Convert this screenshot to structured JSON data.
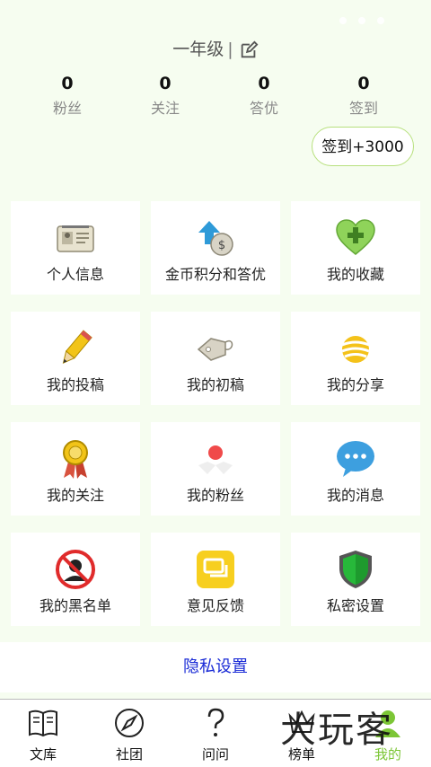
{
  "header": {
    "grade": "一年级",
    "separator": "|",
    "stats": [
      {
        "value": "0",
        "label": "粉丝"
      },
      {
        "value": "0",
        "label": "关注"
      },
      {
        "value": "0",
        "label": "答优"
      },
      {
        "value": "0",
        "label": "签到"
      }
    ],
    "signin_label": "签到+3000"
  },
  "grid": {
    "items": [
      {
        "label": "个人信息",
        "icon": "id-card-icon"
      },
      {
        "label": "金币积分和答优",
        "icon": "coin-upload-icon"
      },
      {
        "label": "我的收藏",
        "icon": "heart-plus-icon"
      },
      {
        "label": "我的投稿",
        "icon": "pencil-icon"
      },
      {
        "label": "我的初稿",
        "icon": "tag-icon"
      },
      {
        "label": "我的分享",
        "icon": "striped-ball-icon"
      },
      {
        "label": "我的关注",
        "icon": "medal-icon"
      },
      {
        "label": "我的粉丝",
        "icon": "red-dot-icon"
      },
      {
        "label": "我的消息",
        "icon": "chat-bubble-icon"
      },
      {
        "label": "我的黑名单",
        "icon": "blocked-person-icon"
      },
      {
        "label": "意见反馈",
        "icon": "feedback-icon"
      },
      {
        "label": "私密设置",
        "icon": "shield-icon"
      }
    ]
  },
  "privacy_link": "隐私设置",
  "tabbar": {
    "tabs": [
      {
        "label": "文库",
        "icon": "book-icon"
      },
      {
        "label": "社团",
        "icon": "compass-icon"
      },
      {
        "label": "问问",
        "icon": "question-icon"
      },
      {
        "label": "榜单",
        "icon": "ranking-icon"
      },
      {
        "label": "我的",
        "icon": "profile-icon",
        "active": true
      }
    ]
  },
  "watermark": "大玩客",
  "colors": {
    "accent": "#7cc636",
    "link": "#1a2bd6",
    "background": "#f6fdf0"
  }
}
